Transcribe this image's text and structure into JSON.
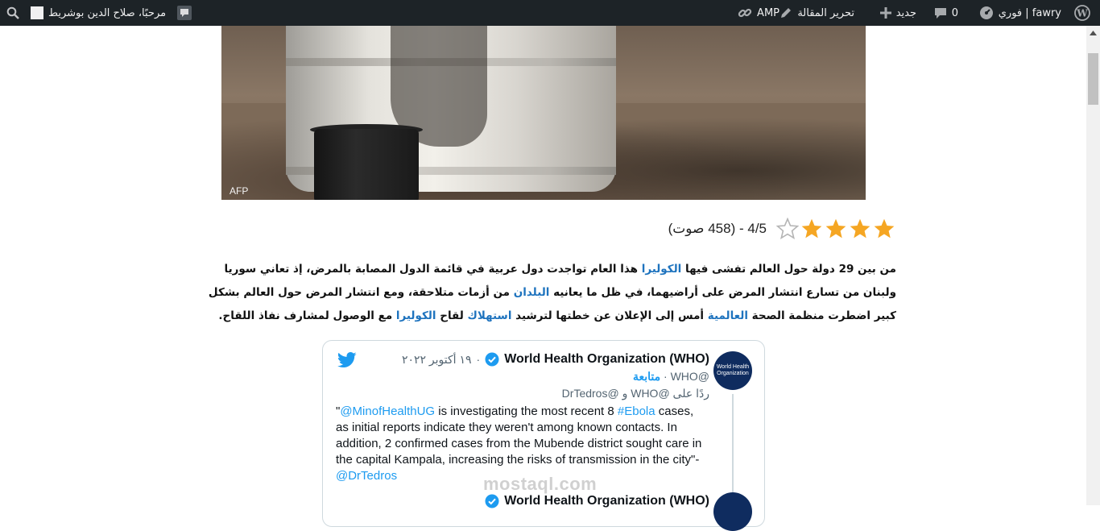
{
  "adminbar": {
    "site_name": "fawry | فوري",
    "comments_count": "0",
    "new_label": "جديد",
    "edit_label": "تحرير المقالة",
    "amp_label": "AMP",
    "greeting": "مرحبًا، صلاح الدين بوشريط"
  },
  "hero": {
    "credit": "AFP"
  },
  "rating": {
    "text": "4/5 - (458 صوت)",
    "value": 4,
    "max": 5,
    "star_color": "#f5a623"
  },
  "article": {
    "s1": "من بين 29 دولة حول العالم تفشى فيها ",
    "l1": "الكوليرا",
    "s2": " هذا العام تواجدت دول عربية في قائمة الدول المصابة بالمرض، إذ تعاني سوريا ولبنان من تسارع انتشار المرض على أراضيهما، في ظل ما يعانيه ",
    "l2": "البلدان",
    "s3": " من أزمات متلاحقة، ومع انتشار المرض حول العالم بشكل كبير اضطرت منظمة الصحة ",
    "l3": "العالمية",
    "s4": " أمس إلى الإعلان عن خطتها لترشيد ",
    "l4": "استهلاك",
    "s5": " لقاح ",
    "l5": "الكوليرا",
    "s6": " مع الوصول لمشارف نفاذ اللقاح."
  },
  "tweet": {
    "author": "World Health Organization (WHO)",
    "date": "١٩ أكتوبر ٢٠٢٢",
    "handle": "@WHO",
    "follow_label": "متابعة",
    "reply_to": "ردًا على @WHO و @DrTedros",
    "avatar_text": "World Health Organization",
    "body_quote_open": "\"",
    "mention1": "@MinofHealthUG",
    "body_part1": " is investigating the most recent 8 ",
    "hashtag": "#Ebola",
    "body_part2": " cases, as initial reports indicate they weren't among known contacts. In addition, 2 confirmed cases from the Mubende district sought care in the capital Kampala, increasing the risks of transmission in the city\"-",
    "mention2": "@DrTedros",
    "next_author": "World Health Organization (WHO)"
  },
  "watermark": "mostaql.com"
}
